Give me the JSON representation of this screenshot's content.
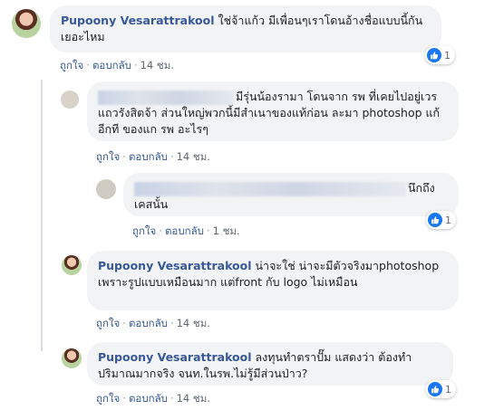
{
  "comments": [
    {
      "author": "Pupoony Vesarattrakool",
      "text": "ใช่จ้าแก้ว มีเพื่อนๆเราโดนอ้างชื่อแบบนี้กันเยอะไหม",
      "like_label": "ถูกใจ",
      "reply_label": "ตอบกลับ",
      "time": "14 ชม.",
      "reaction_count": "1"
    },
    {
      "author": "",
      "text": "มีรุ่นน้องรามา โดนจาก รพ ที่เคยไปอยู่เวร แถวรังสิตจ้า ส่วนใหญ่พวกนี้มีสำเนาของแท้ก่อน ละมา photoshop แก้อีกที ของแก รพ อะไรๆ",
      "like_label": "ถูกใจ",
      "reply_label": "ตอบกลับ",
      "time": "14 ชม."
    },
    {
      "author": "",
      "text": "นึกถึงเคสนั้น",
      "like_label": "ถูกใจ",
      "reply_label": "ตอบกลับ",
      "time": "1 ชม.",
      "reaction_count": "1"
    },
    {
      "author": "Pupoony Vesarattrakool",
      "text": "น่าจะใช่ น่าจะมีตัวจริงมาphotoshop เพราะรูปแบบเหมือนมาก แต่front กับ logo ไม่เหมือน",
      "like_label": "ถูกใจ",
      "reply_label": "ตอบกลับ",
      "time": "14 ชม."
    },
    {
      "author": "Pupoony Vesarattrakool",
      "text": "ลงทุนทำตราปั๊ม แสดงว่า ต้องทำปริมาณมากจริง จนท.ในรพ.ไม่รู้มีส่วนป่าว?",
      "like_label": "ถูกใจ",
      "reply_label": "ตอบกลับ",
      "time": "14 ชม.",
      "reaction_count": "1"
    }
  ],
  "colors": {
    "author": "#385898",
    "bubble": "#f2f3f5",
    "like_blue": "#1877f2"
  },
  "icons": {
    "like": "like-icon",
    "avatar": "avatar-photo"
  }
}
